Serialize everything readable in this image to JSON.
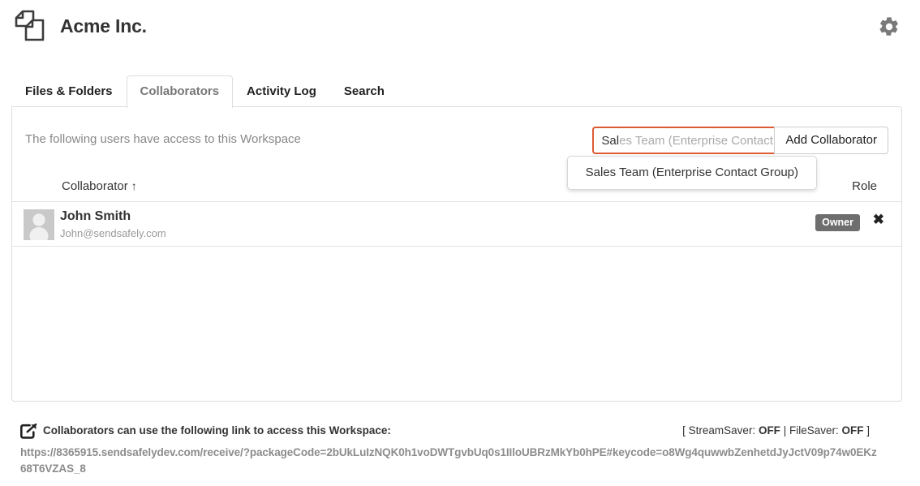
{
  "header": {
    "brand_title": "Acme Inc.",
    "logo_icon": "documents-icon",
    "settings_icon": "gear-icon"
  },
  "tabs": [
    {
      "label": "Files & Folders",
      "active": false
    },
    {
      "label": "Collaborators",
      "active": true
    },
    {
      "label": "Activity Log",
      "active": false
    },
    {
      "label": "Search",
      "active": false
    }
  ],
  "panel": {
    "access_note": "The following users have access to this Workspace",
    "search": {
      "typed_text": "Sal",
      "ghost_text": "es Team (Enterprise Contact",
      "placeholder": "Sales Team (Enterprise Contact",
      "focus_color": "#dd5b34"
    },
    "add_button_label": "Add Collaborator",
    "suggestions": [
      "Sales Team (Enterprise Contact Group)"
    ],
    "table": {
      "columns": {
        "collaborator": "Collaborator",
        "sort_indicator": "↑",
        "role": "Role"
      },
      "rows": [
        {
          "name": "John Smith",
          "email": "John@sendsafely.com",
          "role": "Owner",
          "avatar_icon": "user-avatar-placeholder",
          "remove_icon": "✖"
        }
      ]
    }
  },
  "footer": {
    "share_icon": "share-arrow-icon",
    "label": "Collaborators can use the following link to access this Workspace:",
    "link": "https://8365915.sendsafelydev.com/receive/?packageCode=2bUkLuIzNQK0h1voDWTgvbUq0s1IIloUBRzMkYb0hPE#keycode=o8Wg4quwwbZenhetdJyJctV09p74w0EKz68T6VZAS_8",
    "saver_status": {
      "open_bracket": "[ ",
      "stream_label": "StreamSaver: ",
      "stream_value": "OFF",
      "separator": " | ",
      "file_label": "FileSaver: ",
      "file_value": "OFF",
      "close_bracket": " ]"
    }
  }
}
